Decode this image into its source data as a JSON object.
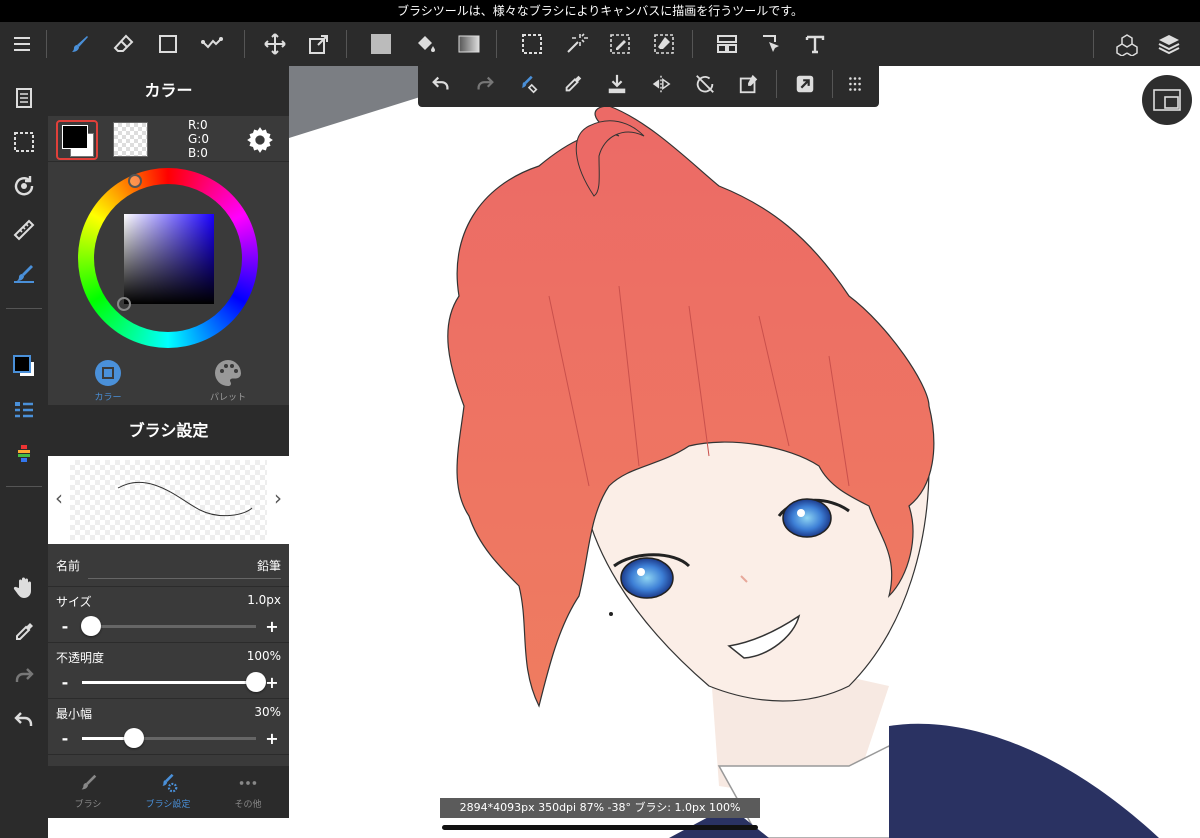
{
  "tooltip": "ブラシツールは、様々なブラシによりキャンバスに描画を行うツールです。",
  "toolbar": {
    "icons": [
      "menu-icon",
      "brush-icon",
      "eraser-icon",
      "rectangle-icon",
      "smudge-icon",
      "move-icon",
      "transform-icon",
      "fill-icon",
      "bucket-icon",
      "gradient-icon",
      "select-icon",
      "magic-wand-icon",
      "select-pen-icon",
      "select-eraser-icon",
      "frame-icon",
      "operation-icon",
      "text-icon",
      "3d-icon",
      "layers-icon"
    ],
    "accent": "#4a90d9"
  },
  "leftcol": {
    "icons": [
      "pages-icon",
      "selection-icon",
      "rotate-icon",
      "ruler-icon",
      "snap-brush-icon",
      "color-swatch-icon",
      "list-icon",
      "gradient-bar-icon",
      "hand-icon",
      "eyedropper-icon",
      "redo-icon",
      "undo-icon"
    ]
  },
  "color_panel": {
    "title": "カラー",
    "r": "R:0",
    "g": "G:0",
    "b": "B:0",
    "foreground": "#000000",
    "background": "#ffffff",
    "hue_color": "#1a00ff",
    "tabs": [
      {
        "label": "カラー",
        "active": true
      },
      {
        "label": "パレット",
        "active": false
      }
    ]
  },
  "brush_panel": {
    "title": "ブラシ設定",
    "name_label": "名前",
    "name_value": "鉛筆",
    "size_label": "サイズ",
    "size_value": "1.0px",
    "size_level": 0.05,
    "opacity_label": "不透明度",
    "opacity_value": "100%",
    "opacity_level": 1.0,
    "minwidth_label": "最小幅",
    "minwidth_value": "30%",
    "minwidth_level": 0.3,
    "minus": "-",
    "plus": "+",
    "prev": "‹",
    "next": "›"
  },
  "bottom_tabs": [
    {
      "label": "ブラシ",
      "active": false
    },
    {
      "label": "ブラシ設定",
      "active": true
    },
    {
      "label": "その他",
      "active": false
    }
  ],
  "subtoolbar": {
    "icons": [
      "undo-icon",
      "redo-icon",
      "brush-eraser-icon",
      "eyedropper-icon",
      "download-icon",
      "flip-icon",
      "rotate-lock-icon",
      "clear-icon",
      "export-icon",
      "more-icon"
    ]
  },
  "status": "2894*4093px 350dpi 87% -38° ブラシ: 1.0px 100%",
  "canvas": {
    "hair_color": "#ec6f68",
    "eye_color": "#3d7fd6",
    "jacket_color": "#2a3262"
  }
}
